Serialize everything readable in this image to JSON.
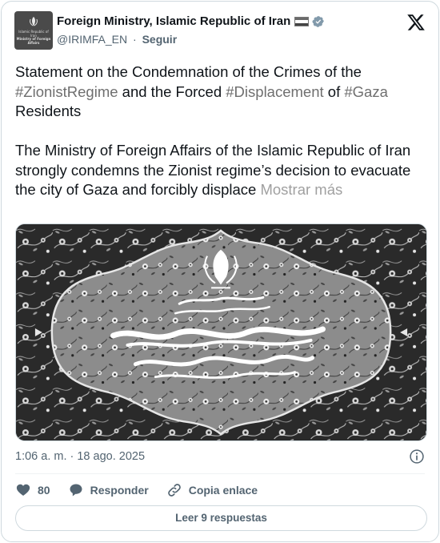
{
  "account": {
    "name": "Foreign Ministry, Islamic Republic of Iran",
    "handle": "@IRIMFA_EN",
    "separator": "·",
    "follow_label": "Seguir",
    "avatar_line1": "Islamic Republic of Iran",
    "avatar_line2": "Ministry of Foreign Affairs",
    "verified_icon": "verified-badge-icon",
    "flag_icon": "iran-flag-icon"
  },
  "tweet": {
    "p1_a": "Statement on the Condemnation of the Crimes of the ",
    "p1_tag1": "#ZionistRegime",
    "p1_b": " and the Forced ",
    "p1_tag2": "#Displacement",
    "p1_c": " of ",
    "p1_tag3": "#Gaza",
    "p1_d": "\nResidents",
    "p2": "\n\nThe Ministry of Foreign Affairs of the Islamic Republic of Iran strongly condemns the Zionist regime’s decision to evacuate the city of Gaza and forcibly displace ",
    "show_more": "Mostrar más"
  },
  "media": {
    "alt_description_icon": "ministry-emblem-image"
  },
  "meta": {
    "timestamp": "1:06 a. m. · 18 ago. 2025"
  },
  "actions": {
    "like_count": "80",
    "reply_label": "Responder",
    "copy_label": "Copia enlace"
  },
  "read_replies_label": "Leer 9 respuestas",
  "colors": {
    "text": "#0f1419",
    "muted": "#536471",
    "hashtag": "#6f6f6f",
    "border": "#cfd9de"
  }
}
